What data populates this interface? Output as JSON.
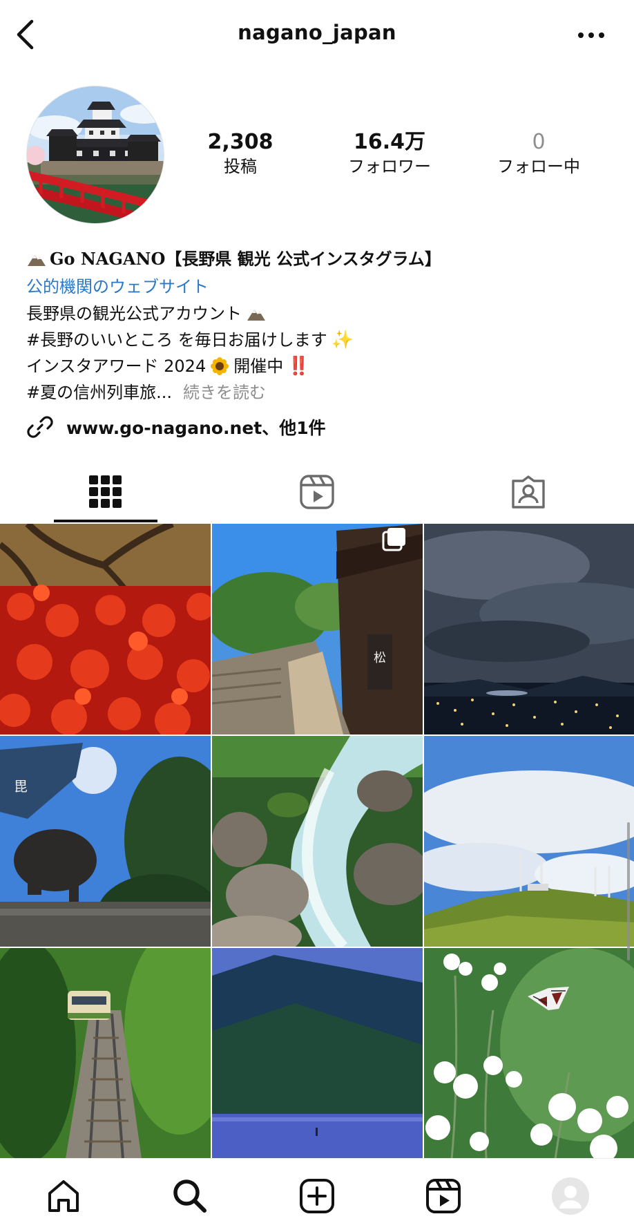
{
  "header": {
    "username": "nagano_japan"
  },
  "stats": {
    "posts": {
      "value": "2,308",
      "label": "投稿"
    },
    "followers": {
      "value": "16.4万",
      "label": "フォロワー"
    },
    "following": {
      "value": "0",
      "label": "フォロー中"
    }
  },
  "bio": {
    "name": "Go NAGANO【長野県 観光 公式インスタグラム】",
    "category": "公的機関のウェブサイト",
    "line1": "長野県の観光公式アカウント",
    "line2": "#長野のいいところ を毎日お届けします",
    "line3_prefix": "インスタアワード 2024",
    "line3_suffix": "開催中",
    "line3_excl": "‼️",
    "line4": "#夏の信州列車旅...",
    "more": "続きを読む"
  },
  "link": {
    "text": "www.go-nagano.net、他1件"
  },
  "tabs": [
    {
      "icon": "grid-icon",
      "active": true
    },
    {
      "icon": "reels-icon",
      "active": false
    },
    {
      "icon": "tagged-icon",
      "active": false
    }
  ],
  "grid": [
    {
      "subject": "red spider lilies under tree"
    },
    {
      "subject": "old post town street with stairs",
      "multi_post": true
    },
    {
      "subject": "night city view under cloudy sky"
    },
    {
      "subject": "samurai statue with banners and sun"
    },
    {
      "subject": "mountain stream with rocks"
    },
    {
      "subject": "hilltop with antennas and blue sky"
    },
    {
      "subject": "train on rails in green forest"
    },
    {
      "subject": "blue mountain lake"
    },
    {
      "subject": "butterfly on white flowers"
    }
  ],
  "nav": [
    {
      "icon": "home-icon"
    },
    {
      "icon": "search-icon"
    },
    {
      "icon": "create-icon"
    },
    {
      "icon": "reels-icon"
    },
    {
      "icon": "profile-icon"
    }
  ],
  "colors": {
    "link_blue": "#2a79c8",
    "muted": "#8e8e8e",
    "accent_red": "#d61b1b"
  }
}
